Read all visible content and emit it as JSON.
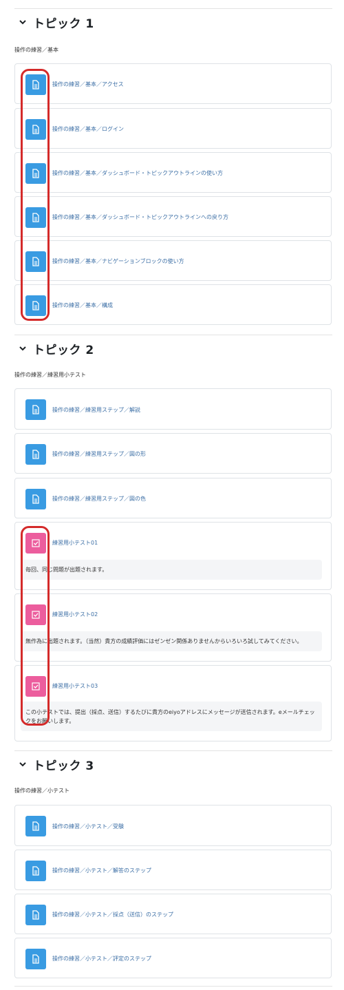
{
  "topics": [
    {
      "title": "トピック 1",
      "summary": "操作の練習／基本",
      "activities": [
        {
          "label": "操作の練習／基本／アクセス"
        },
        {
          "label": "操作の練習／基本／ログイン"
        },
        {
          "label": "操作の練習／基本／ダッシュボード・トピックアウトラインの使い方"
        },
        {
          "label": "操作の練習／基本／ダッシュボード・トピックアウトラインへの戻り方"
        },
        {
          "label": "操作の練習／基本／ナビゲーションブロックの使い方"
        },
        {
          "label": "操作の練習／基本／構成"
        }
      ]
    },
    {
      "title": "トピック 2",
      "summary": "操作の練習／練習用小テスト",
      "activities": [
        {
          "label": "操作の練習／練習用ステップ／解説"
        },
        {
          "label": "操作の練習／練習用ステップ／図の形"
        },
        {
          "label": "操作の練習／練習用ステップ／図の色"
        },
        {
          "label": "練習用小テスト01",
          "description": "毎回、同じ問題が出題されます。"
        },
        {
          "label": "練習用小テスト02",
          "description": "無作為に出題されます。（当然）貴方の成績評価にはゼンゼン関係ありませんからいろいろ試してみてください。"
        },
        {
          "label": "練習用小テスト03",
          "description": "この小テストでは、提出（採点、送信）するたびに貴方のeiyoアドレスにメッセージが送信されます。eメールチェックをお願いします。"
        }
      ]
    },
    {
      "title": "トピック 3",
      "summary": "操作の練習／小テスト",
      "activities": [
        {
          "label": "操作の練習／小テスト／受験"
        },
        {
          "label": "操作の練習／小テスト／解答のステップ"
        },
        {
          "label": "操作の練習／小テスト／採点（送信）のステップ"
        },
        {
          "label": "操作の練習／小テスト／評定のステップ"
        }
      ]
    }
  ],
  "icons": {
    "page": "page-icon",
    "quiz": "quiz-icon",
    "collapse": "chevron-down-icon"
  },
  "colors": {
    "page_icon": "#399be2",
    "quiz_icon": "#ec5d9d",
    "link": "#3b6ea5",
    "highlight": "#d42a2a"
  }
}
